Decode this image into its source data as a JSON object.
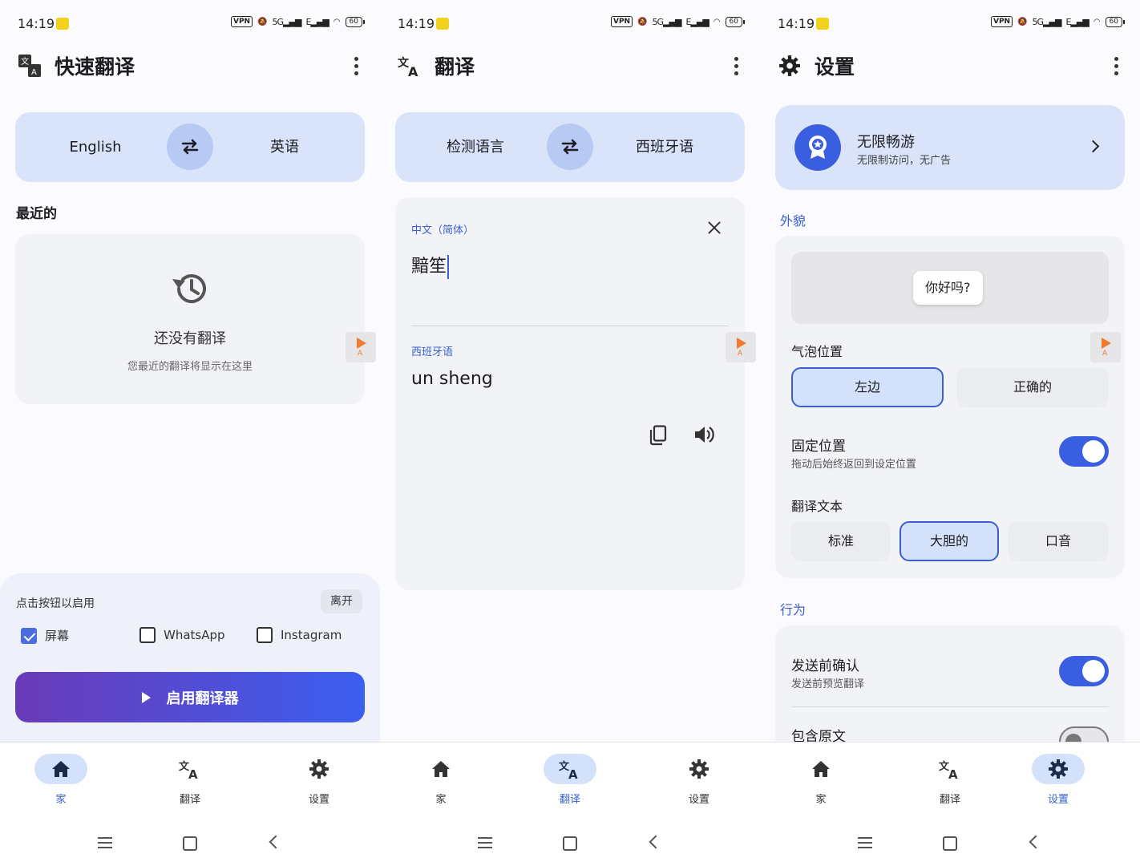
{
  "status": {
    "time": "14:19",
    "vpn": "VPN",
    "network": "5G",
    "network2": "E",
    "battery": "60"
  },
  "home": {
    "title": "快速翻译",
    "source_lang": "English",
    "target_lang": "英语",
    "recent_heading": "最近的",
    "empty_title": "还没有翻译",
    "empty_subtitle": "您最近的翻译将显示在这里",
    "sheet_hint": "点击按钮以启用",
    "leave_label": "离开",
    "checkboxes": [
      {
        "label": "屏幕",
        "checked": true
      },
      {
        "label": "WhatsApp",
        "checked": false
      },
      {
        "label": "Instagram",
        "checked": false
      }
    ],
    "enable_label": "启用翻译器"
  },
  "translate": {
    "title": "翻译",
    "source_lang": "检测语言",
    "target_lang": "西班牙语",
    "detected_label": "中文（简体）",
    "input_text": "黯笙",
    "output_label": "西班牙语",
    "output_text": "un sheng"
  },
  "settings": {
    "title": "设置",
    "promo_title": "无限畅游",
    "promo_subtitle": "无限制访问，无广告",
    "appearance_heading": "外貌",
    "preview_bubble": "你好吗?",
    "bubble_position_label": "气泡位置",
    "position_options": [
      {
        "label": "左边",
        "selected": true
      },
      {
        "label": "正确的",
        "selected": false
      }
    ],
    "fixed_position_label": "固定位置",
    "fixed_position_sub": "拖动后始终返回到设定位置",
    "fixed_position_on": true,
    "translate_text_label": "翻译文本",
    "text_options": [
      {
        "label": "标准",
        "selected": false
      },
      {
        "label": "大胆的",
        "selected": true
      },
      {
        "label": "口音",
        "selected": false
      }
    ],
    "behavior_heading": "行为",
    "confirm_label": "发送前确认",
    "confirm_sub": "发送前预览翻译",
    "confirm_on": true,
    "include_original_label": "包含原文",
    "include_original_on": false
  },
  "nav": {
    "home": "家",
    "translate": "翻译",
    "settings": "设置"
  },
  "ad_badge": "A",
  "colors": {
    "accent": "#3a5ee0",
    "pill": "#d4e1fb",
    "lang_bar": "#d9e4fb",
    "card": "#f2f3f7"
  }
}
